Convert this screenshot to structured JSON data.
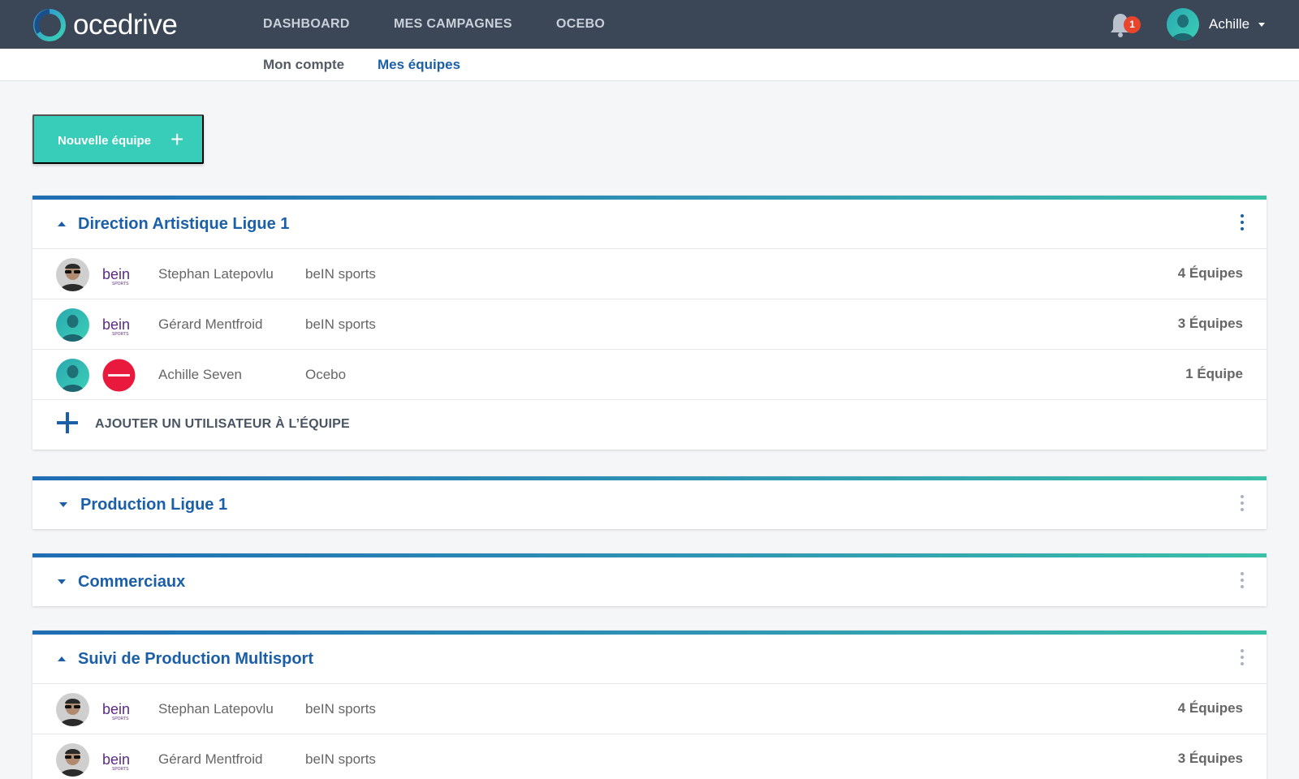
{
  "app": {
    "brand": "ocedrive"
  },
  "nav": {
    "items": [
      {
        "label": "DASHBOARD"
      },
      {
        "label": "MES CAMPAGNES"
      },
      {
        "label": "OCEBO"
      }
    ]
  },
  "notifications": {
    "count": "1",
    "icon": "bell-icon"
  },
  "user": {
    "name": "Achille"
  },
  "subnav": {
    "items": [
      {
        "label": "Mon compte",
        "active": false
      },
      {
        "label": "Mes équipes",
        "active": true
      }
    ]
  },
  "new_team_button": {
    "label": "Nouvelle équipe",
    "icon": "+"
  },
  "add_user_label": "AJOUTER UN UTILISATEUR À L’ÉQUIPE",
  "teams": [
    {
      "name": "Direction Artistique Ligue 1",
      "expanded": true,
      "members": [
        {
          "name": "Stephan Latepovlu",
          "company": "beIN sports",
          "teams": "4 Équipes",
          "org_logo": "bein",
          "avatar": "sunglasses"
        },
        {
          "name": "Gérard Mentfroid",
          "company": "beIN sports",
          "teams": "3 Équipes",
          "org_logo": "bein",
          "avatar": "teal"
        },
        {
          "name": "Achille Seven",
          "company": "Ocebo",
          "teams": "1 Équipe",
          "org_logo": "ocebo",
          "avatar": "teal"
        }
      ]
    },
    {
      "name": "Production Ligue 1",
      "expanded": false,
      "members": []
    },
    {
      "name": "Commerciaux",
      "expanded": false,
      "members": []
    },
    {
      "name": "Suivi de Production Multisport",
      "expanded": true,
      "members": [
        {
          "name": "Stephan Latepovlu",
          "company": "beIN sports",
          "teams": "4 Équipes",
          "org_logo": "bein",
          "avatar": "sunglasses"
        },
        {
          "name": "Gérard Mentfroid",
          "company": "beIN sports",
          "teams": "3 Équipes",
          "org_logo": "bein",
          "avatar": "sunglasses"
        }
      ]
    }
  ],
  "colors": {
    "topbar": "#3b4757",
    "accent": "#38cdb9",
    "primary_blue": "#1b5fa8",
    "badge": "#e8452c",
    "ocebo_red": "#e8193c",
    "bein_purple": "#5b2a86"
  }
}
